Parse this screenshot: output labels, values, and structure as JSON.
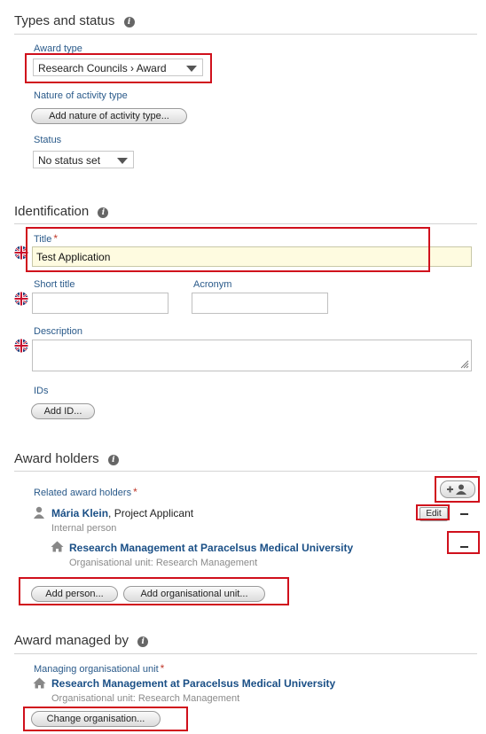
{
  "types_status": {
    "title": "Types and status",
    "award_type_label": "Award type",
    "award_type_value": "Research Councils › Award",
    "nature_label": "Nature of activity type",
    "nature_button": "Add nature of activity type...",
    "status_label": "Status",
    "status_value": "No status set"
  },
  "identification": {
    "title": "Identification",
    "title_label": "Title",
    "title_value": "Test Application",
    "short_title_label": "Short title",
    "acronym_label": "Acronym",
    "description_label": "Description",
    "ids_label": "IDs",
    "add_id_button": "Add ID..."
  },
  "award_holders": {
    "title": "Award holders",
    "related_label": "Related award holders",
    "person_name": "Mária Klein",
    "person_role": ", Project Applicant",
    "edit_label": "Edit",
    "person_type": "Internal person",
    "org_name": "Research Management at Paracelsus Medical University",
    "org_sub": "Organisational unit: Research Management",
    "add_person_button": "Add person...",
    "add_org_button": "Add organisational unit..."
  },
  "award_managed": {
    "title": "Award managed by",
    "managing_label": "Managing organisational unit",
    "org_name": "Research Management at Paracelsus Medical University",
    "org_sub": "Organisational unit: Research Management",
    "change_button": "Change organisation..."
  },
  "icons": {
    "info": "info-icon",
    "flag": "uk-flag-icon",
    "person": "person-icon",
    "org": "house-icon",
    "add_person": "add-person-icon"
  },
  "colors": {
    "highlight": "#d0101c",
    "link": "#1a4f86",
    "label": "#2a5a8a",
    "title_field_bg": "#fefbe0"
  }
}
